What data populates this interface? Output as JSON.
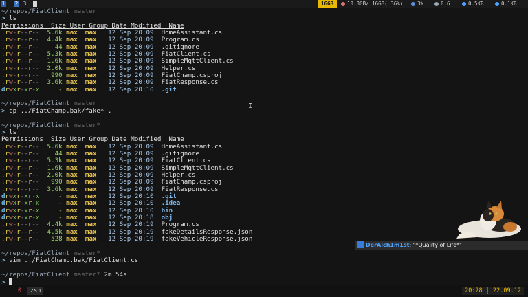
{
  "topbar": {
    "workspaces": [
      "1",
      "2",
      "3"
    ],
    "ram_badge": "16GB",
    "disk": "10.8GB/ 16GB( 36%)",
    "cpu": "3%",
    "load": "0.6",
    "net_down": "0.5KB",
    "net_up": "0.1KB"
  },
  "terminal": {
    "prompts": [
      {
        "path": "~/repos/FiatClient",
        "branch": "master"
      },
      {
        "path": "~/repos/FiatClient",
        "branch": "master"
      },
      {
        "path": "~/repos/FiatClient",
        "branch": "master*"
      },
      {
        "path": "~/repos/FiatClient",
        "branch": "master*"
      },
      {
        "path": "~/repos/FiatClient",
        "branch": "master*",
        "duration": "2m 54s"
      }
    ],
    "prompt_symbol": ">",
    "commands": [
      "ls",
      "cp ../FiatChamp.bak/fake* .",
      "ls",
      "vim ../FiatChamp.bak/FiatClient.cs"
    ],
    "headers": {
      "permissions": "Permissions",
      "size": "Size",
      "user": "User",
      "group": "Group",
      "date": "Date Modified",
      "name": "Name"
    },
    "listing1": [
      {
        "perm": ".rw-r--r--",
        "size": "5.6k",
        "user": "max",
        "group": "max",
        "date": "12 Sep 20:09",
        "name": "HomeAssistant.cs"
      },
      {
        "perm": ".rw-r--r--",
        "size": "4.4k",
        "user": "max",
        "group": "max",
        "date": "12 Sep 20:09",
        "name": "Program.cs"
      },
      {
        "perm": ".rw-r--r--",
        "size": "44",
        "user": "max",
        "group": "max",
        "date": "12 Sep 20:09",
        "name": ".gitignore"
      },
      {
        "perm": ".rw-r--r--",
        "size": "5.3k",
        "user": "max",
        "group": "max",
        "date": "12 Sep 20:09",
        "name": "FiatClient.cs"
      },
      {
        "perm": ".rw-r--r--",
        "size": "1.6k",
        "user": "max",
        "group": "max",
        "date": "12 Sep 20:09",
        "name": "SimpleMqttClient.cs"
      },
      {
        "perm": ".rw-r--r--",
        "size": "2.0k",
        "user": "max",
        "group": "max",
        "date": "12 Sep 20:09",
        "name": "Helper.cs"
      },
      {
        "perm": ".rw-r--r--",
        "size": "990",
        "user": "max",
        "group": "max",
        "date": "12 Sep 20:09",
        "name": "FiatChamp.csproj"
      },
      {
        "perm": ".rw-r--r--",
        "size": "3.6k",
        "user": "max",
        "group": "max",
        "date": "12 Sep 20:09",
        "name": "FiatResponse.cs"
      },
      {
        "perm": "drwxr-xr-x",
        "size": "-",
        "user": "max",
        "group": "max",
        "date": "12 Sep 20:10",
        "name": ".git",
        "dir": true
      }
    ],
    "listing2": [
      {
        "perm": ".rw-r--r--",
        "size": "5.6k",
        "user": "max",
        "group": "max",
        "date": "12 Sep 20:09",
        "name": "HomeAssistant.cs"
      },
      {
        "perm": ".rw-r--r--",
        "size": "44",
        "user": "max",
        "group": "max",
        "date": "12 Sep 20:09",
        "name": ".gitignore"
      },
      {
        "perm": ".rw-r--r--",
        "size": "5.3k",
        "user": "max",
        "group": "max",
        "date": "12 Sep 20:09",
        "name": "FiatClient.cs"
      },
      {
        "perm": ".rw-r--r--",
        "size": "1.6k",
        "user": "max",
        "group": "max",
        "date": "12 Sep 20:09",
        "name": "SimpleMqttClient.cs"
      },
      {
        "perm": ".rw-r--r--",
        "size": "2.0k",
        "user": "max",
        "group": "max",
        "date": "12 Sep 20:09",
        "name": "Helper.cs"
      },
      {
        "perm": ".rw-r--r--",
        "size": "990",
        "user": "max",
        "group": "max",
        "date": "12 Sep 20:09",
        "name": "FiatChamp.csproj"
      },
      {
        "perm": ".rw-r--r--",
        "size": "3.6k",
        "user": "max",
        "group": "max",
        "date": "12 Sep 20:09",
        "name": "FiatResponse.cs"
      },
      {
        "perm": "drwxr-xr-x",
        "size": "-",
        "user": "max",
        "group": "max",
        "date": "12 Sep 20:10",
        "name": ".git",
        "dir": true
      },
      {
        "perm": "drwxr-xr-x",
        "size": "-",
        "user": "max",
        "group": "max",
        "date": "12 Sep 20:10",
        "name": ".idea",
        "dir": true
      },
      {
        "perm": "drwxr-xr-x",
        "size": "-",
        "user": "max",
        "group": "max",
        "date": "12 Sep 20:10",
        "name": "bin",
        "dir": true
      },
      {
        "perm": "drwxr-xr-x",
        "size": "-",
        "user": "max",
        "group": "max",
        "date": "12 Sep 20:18",
        "name": "obj",
        "dir": true
      },
      {
        "perm": ".rw-r--r--",
        "size": "4.4k",
        "user": "max",
        "group": "max",
        "date": "12 Sep 20:19",
        "name": "Program.cs"
      },
      {
        "perm": ".rw-r--r--",
        "size": "4.5k",
        "user": "max",
        "group": "max",
        "date": "12 Sep 20:19",
        "name": "fakeDetailsResponse.json"
      },
      {
        "perm": ".rw-r--r--",
        "size": "528",
        "user": "max",
        "group": "max",
        "date": "12 Sep 20:19",
        "name": "fakeVehicleResponse.json"
      }
    ]
  },
  "chat": {
    "user": "DerAlch1m1st",
    "message": ": \"*Quality of Life*\""
  },
  "tmux": {
    "window_index": "0",
    "window_name": "zsh",
    "time": "20:28",
    "date": "22.09.12"
  }
}
